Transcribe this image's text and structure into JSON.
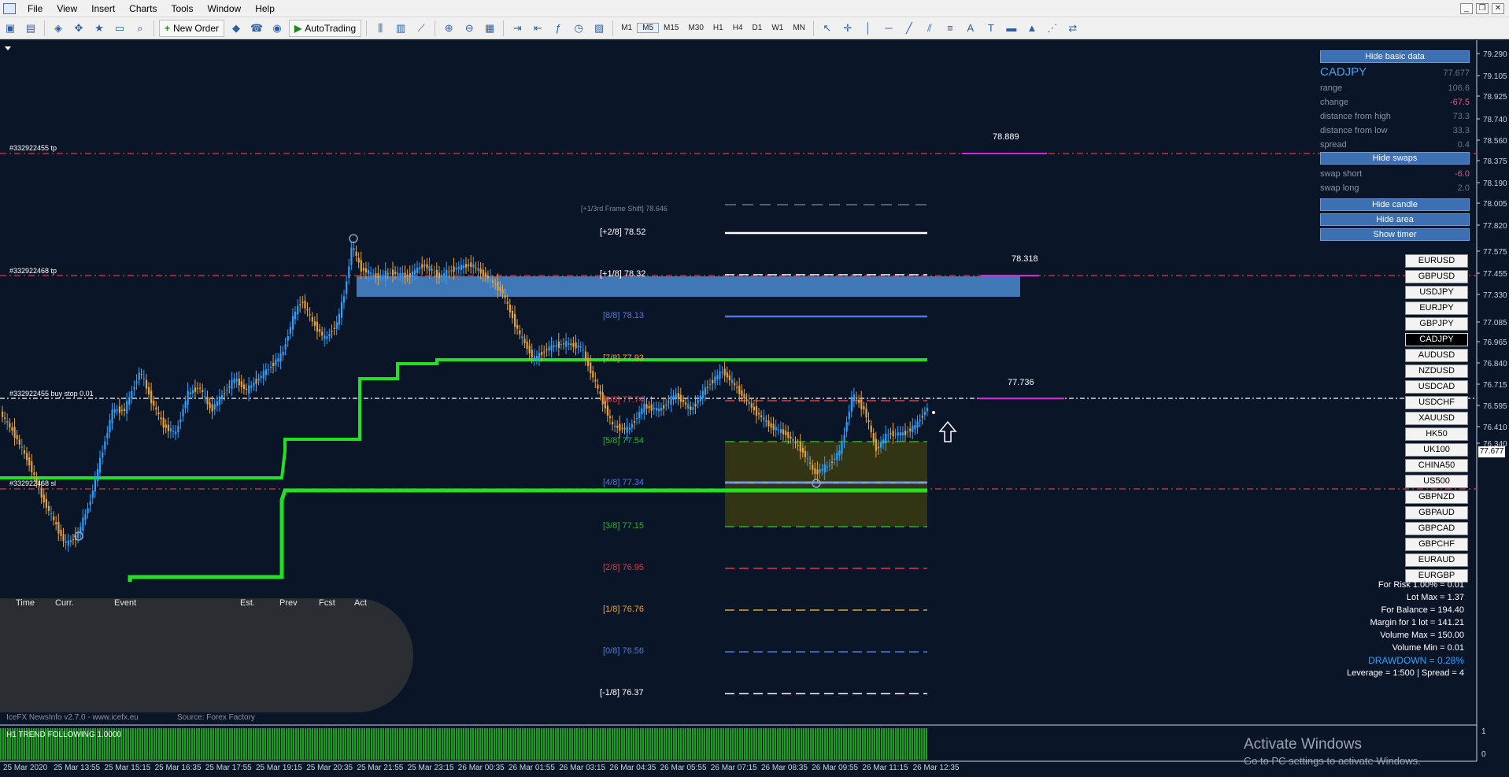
{
  "menubar": {
    "items": [
      "File",
      "View",
      "Insert",
      "Charts",
      "Tools",
      "Window",
      "Help"
    ]
  },
  "toolbar": {
    "new_order_label": "New Order",
    "autotrading_label": "AutoTrading",
    "timeframes": [
      "M1",
      "M5",
      "M15",
      "M30",
      "H1",
      "H4",
      "D1",
      "W1",
      "MN"
    ],
    "active_timeframe": "M5"
  },
  "price_axis": {
    "ticks": [
      "79.290",
      "79.105",
      "78.925",
      "78.740",
      "78.560",
      "78.375",
      "78.190",
      "78.005",
      "77.820",
      "77.575",
      "77.455",
      "77.330",
      "77.085",
      "76.965",
      "76.840",
      "76.715",
      "76.595",
      "76.410",
      "76.340"
    ],
    "current_price": "77.677",
    "bottom_label": "0",
    "top_label": "1"
  },
  "chart_labels": {
    "order_tp_top": "#332922455 tp",
    "order_tp_mid": "#332922468 tp",
    "order_buy_stop": "#332922455 buy stop 0.01",
    "order_sl": "#332922468 sl",
    "level_878889": "78.889",
    "level_78318": "78.318",
    "level_77736": "77.736",
    "frame_shift_label": "[+1/3rd Frame Shift]",
    "frame_shift_value": "78.646"
  },
  "murrey": [
    {
      "label": "[+2/8]",
      "value": "78.52",
      "color": "#ffffff"
    },
    {
      "label": "[+1/8]",
      "value": "78.32",
      "color": "#ffffff"
    },
    {
      "label": "[8/8]",
      "value": "78.13",
      "color": "#4a7ae8"
    },
    {
      "label": "[7/8]",
      "value": "77.93",
      "color": "#e8a23a"
    },
    {
      "label": "[6/8]",
      "value": "77.74",
      "color": "#e83a3a"
    },
    {
      "label": "[5/8]",
      "value": "77.54",
      "color": "#2fb02f"
    },
    {
      "label": "[4/8]",
      "value": "77.34",
      "color": "#4a7ae8"
    },
    {
      "label": "[3/8]",
      "value": "77.15",
      "color": "#2fb02f"
    },
    {
      "label": "[2/8]",
      "value": "76.95",
      "color": "#e83a3a"
    },
    {
      "label": "[1/8]",
      "value": "76.76",
      "color": "#e8a23a"
    },
    {
      "label": "[0/8]",
      "value": "76.56",
      "color": "#4a7ae8"
    },
    {
      "label": "[-1/8]",
      "value": "76.37",
      "color": "#ffffff"
    }
  ],
  "info_panel": {
    "hide_basic_data": "Hide basic data",
    "symbol": "CADJPY",
    "price": "77.677",
    "rows": [
      {
        "k": "range",
        "v": "106.6"
      },
      {
        "k": "change",
        "v": "-67.5"
      },
      {
        "k": "distance from high",
        "v": "73.3"
      },
      {
        "k": "distance from low",
        "v": "33.3"
      },
      {
        "k": "spread",
        "v": "0.4"
      }
    ],
    "hide_swaps": "Hide swaps",
    "swap_rows": [
      {
        "k": "swap short",
        "v": "-6.0"
      },
      {
        "k": "swap long",
        "v": "2.0"
      }
    ],
    "hide_candle": "Hide candle",
    "hide_area": "Hide area",
    "show_timer": "Show timer"
  },
  "symbols": [
    "EURUSD",
    "GBPUSD",
    "USDJPY",
    "EURJPY",
    "GBPJPY",
    "CADJPY",
    "AUDUSD",
    "NZDUSD",
    "USDCAD",
    "USDCHF",
    "XAUUSD",
    "HK50",
    "UK100",
    "CHINA50",
    "US500",
    "GBPNZD",
    "GBPAUD",
    "GBPCAD",
    "GBPCHF",
    "EURAUD",
    "EURGBP"
  ],
  "current_symbol": "CADJPY",
  "risk": {
    "for_risk": "For Risk 1.00% = 0.01",
    "lot_max": "Lot Max = 1.37",
    "for_balance": "For Balance = 194.40",
    "margin": "Margin for 1 lot = 141.21",
    "volume_max": "Volume Max = 150.00",
    "volume_min": "Volume Min = 0.01",
    "drawdown": "DRAWDOWN = 0.28%",
    "leverage": "Leverage = 1:500 | Spread = 4"
  },
  "news": {
    "headers": [
      "Time",
      "Curr.",
      "Event",
      "Est.",
      "Prev",
      "Fcst",
      "Act"
    ],
    "footer_left": "IceFX NewsInfo v2.7.0 - www.icefx.eu",
    "footer_right": "Source: Forex Factory"
  },
  "sub_window": {
    "label": "H1 TREND FOLLOWING 1.0000"
  },
  "time_axis": [
    "25 Mar 2020",
    "25 Mar 13:55",
    "25 Mar 15:15",
    "25 Mar 16:35",
    "25 Mar 17:55",
    "25 Mar 19:15",
    "25 Mar 20:35",
    "25 Mar 21:55",
    "25 Mar 23:15",
    "26 Mar 00:35",
    "26 Mar 01:55",
    "26 Mar 03:15",
    "26 Mar 04:35",
    "26 Mar 05:55",
    "26 Mar 07:15",
    "26 Mar 08:35",
    "26 Mar 09:55",
    "26 Mar 11:15",
    "26 Mar 12:35"
  ],
  "activate": {
    "title": "Activate Windows",
    "subtitle": "Go to PC settings to activate Windows."
  },
  "colors": {
    "background": "#0b1528",
    "bull_candle": "#2ca0ff",
    "bear_candle": "#e8a23a",
    "trend_line": "#22e022",
    "zone_blue": "#4a8ad0",
    "zone_olive": "#3a3a10",
    "tp_line": "#e03a3a",
    "magenta": "#e020e0"
  }
}
